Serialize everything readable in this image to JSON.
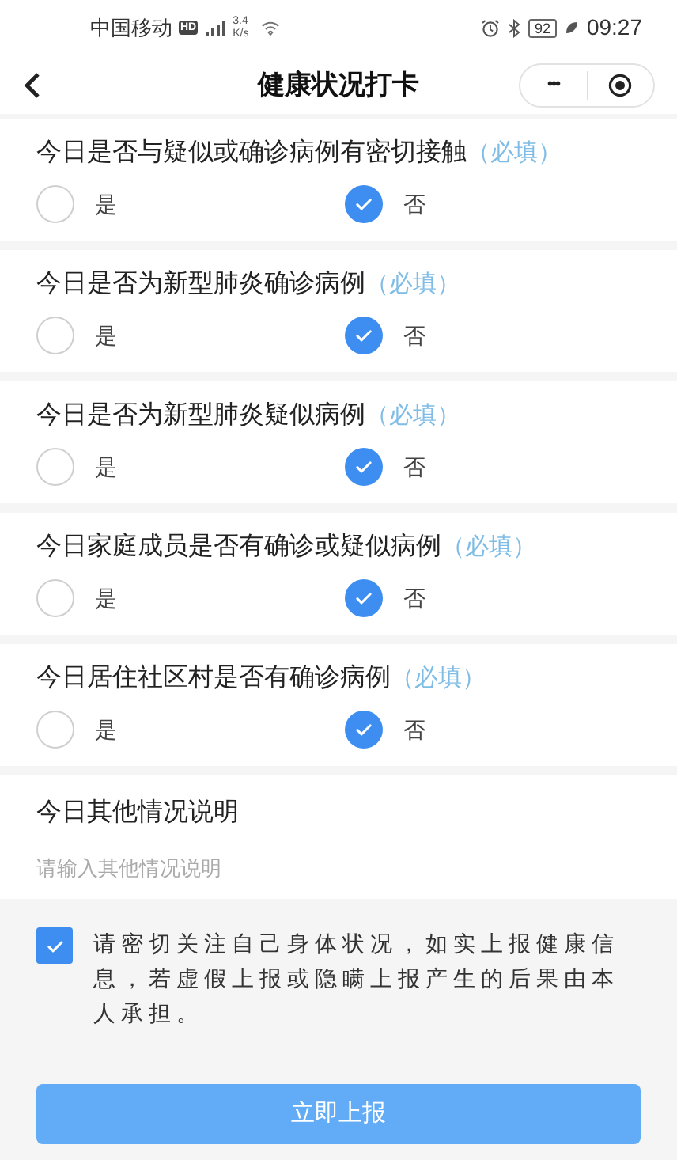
{
  "status_bar": {
    "carrier": "中国移动",
    "hd": "HD",
    "speed_value": "3.4",
    "speed_unit": "K/s",
    "battery": "92",
    "time": "09:27"
  },
  "nav": {
    "title": "健康状况打卡",
    "more": "•••"
  },
  "questions": [
    {
      "label": "今日是否与疑似或确诊病例有密切接触",
      "required": "（必填）",
      "options": [
        {
          "label": "是",
          "selected": false
        },
        {
          "label": "否",
          "selected": true
        }
      ]
    },
    {
      "label": "今日是否为新型肺炎确诊病例",
      "required": "（必填）",
      "options": [
        {
          "label": "是",
          "selected": false
        },
        {
          "label": "否",
          "selected": true
        }
      ]
    },
    {
      "label": "今日是否为新型肺炎疑似病例",
      "required": "（必填）",
      "options": [
        {
          "label": "是",
          "selected": false
        },
        {
          "label": "否",
          "selected": true
        }
      ]
    },
    {
      "label": "今日家庭成员是否有确诊或疑似病例",
      "required": "（必填）",
      "options": [
        {
          "label": "是",
          "selected": false
        },
        {
          "label": "否",
          "selected": true
        }
      ]
    },
    {
      "label": "今日居住社区村是否有确诊病例",
      "required": "（必填）",
      "options": [
        {
          "label": "是",
          "selected": false
        },
        {
          "label": "否",
          "selected": true
        }
      ]
    }
  ],
  "other": {
    "label": "今日其他情况说明",
    "placeholder": "请输入其他情况说明"
  },
  "agreement": {
    "checked": true,
    "text": "请密切关注自己身体状况，如实上报健康信息，若虚假上报或隐瞒上报产生的后果由本人承担。"
  },
  "submit": "立即上报"
}
